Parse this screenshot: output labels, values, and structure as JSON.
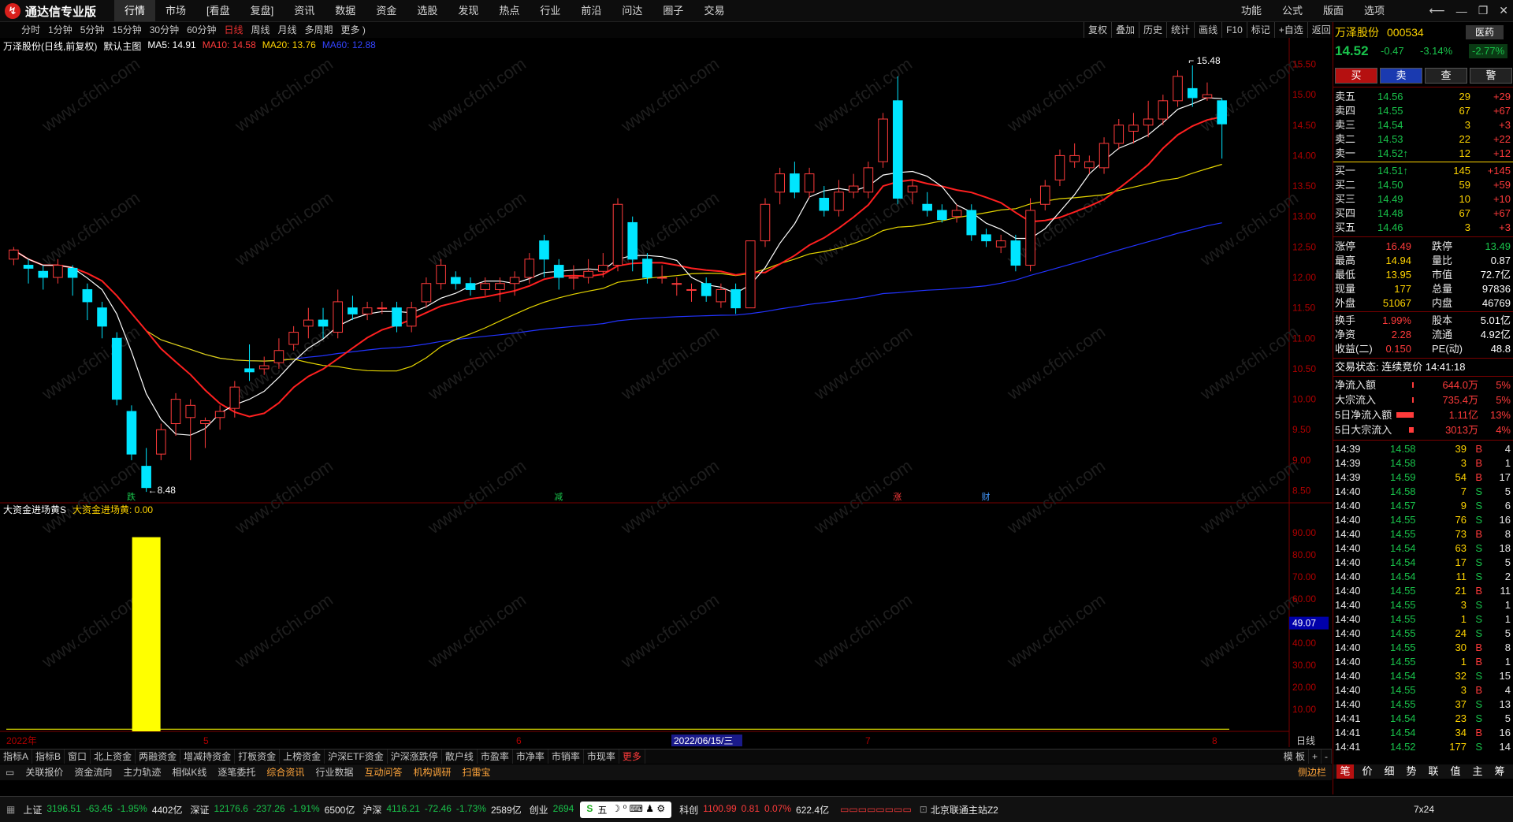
{
  "app": {
    "title": "通达信专业版"
  },
  "menu": [
    "行情",
    "市场",
    "[看盘",
    "复盘]",
    "资讯",
    "数据",
    "资金",
    "选股",
    "发现",
    "热点",
    "行业",
    "前沿",
    "问达",
    "圈子",
    "交易"
  ],
  "menu_active": "行情",
  "right_menu": [
    "功能",
    "公式",
    "版面",
    "选项"
  ],
  "window_controls": [
    "back-arrow",
    "minimize",
    "restore",
    "close"
  ],
  "periods": [
    "分时",
    "1分钟",
    "5分钟",
    "15分钟",
    "30分钟",
    "60分钟",
    "日线",
    "周线",
    "月线",
    "多周期",
    "更多 )"
  ],
  "period_active": "日线",
  "right_tools": [
    "复权",
    "叠加",
    "历史",
    "统计",
    "画线",
    "F10",
    "标记",
    "+自选",
    "返回"
  ],
  "chart_header": {
    "name": "万泽股份(日线,前复权)",
    "theme": "默认主图",
    "ma5": "MA5: 14.91",
    "ma10": "MA10: 14.58",
    "ma20": "MA20: 13.76",
    "ma60": "MA60: 12.88"
  },
  "indicator_header": {
    "name": "大资金进场黄S",
    "value": "大资金进场黄: 0.00"
  },
  "price_axis": [
    "15.50",
    "15.00",
    "14.50",
    "14.00",
    "13.50",
    "13.00",
    "12.50",
    "12.00",
    "11.50",
    "11.00",
    "10.50",
    "10.00",
    "9.50",
    "9.00",
    "8.50"
  ],
  "ind_axis": [
    "90.00",
    "80.00",
    "70.00",
    "60.00",
    "49.07",
    "40.00",
    "30.00",
    "20.00",
    "10.00"
  ],
  "time_axis": {
    "start": "2022年",
    "m5": "5",
    "m6": "6",
    "cursor_date": "2022/06/15/三",
    "m7": "7",
    "m8": "8",
    "period_label": "日线"
  },
  "annotations": {
    "high": "15.48",
    "low": "←8.48",
    "e1": "跌",
    "e2": "减",
    "e3": "涨",
    "e4": "财"
  },
  "chart_data": {
    "type": "candlestick",
    "ylim": [
      8.3,
      15.7
    ],
    "candles": [
      [
        12.3,
        12.45,
        12.2,
        12.5
      ],
      [
        12.2,
        12.15,
        11.9,
        12.3
      ],
      [
        12.1,
        12.0,
        11.8,
        12.2
      ],
      [
        12.0,
        12.2,
        11.9,
        12.3
      ],
      [
        12.15,
        12.0,
        11.7,
        12.2
      ],
      [
        11.8,
        11.6,
        11.3,
        11.9
      ],
      [
        11.5,
        11.2,
        11.0,
        11.6
      ],
      [
        11.0,
        10.0,
        9.9,
        11.1
      ],
      [
        9.8,
        9.1,
        9.0,
        9.9
      ],
      [
        8.9,
        8.55,
        8.48,
        9.2
      ],
      [
        9.1,
        9.5,
        9.0,
        9.6
      ],
      [
        9.6,
        10.0,
        9.4,
        10.1
      ],
      [
        9.7,
        9.9,
        9.0,
        10.0
      ],
      [
        9.6,
        9.65,
        9.2,
        9.7
      ],
      [
        9.7,
        9.8,
        9.5,
        9.9
      ],
      [
        9.85,
        10.2,
        9.7,
        10.3
      ],
      [
        10.5,
        10.45,
        10.3,
        10.9
      ],
      [
        10.5,
        10.55,
        10.4,
        10.7
      ],
      [
        10.6,
        10.8,
        10.5,
        11.0
      ],
      [
        10.9,
        11.1,
        10.8,
        11.2
      ],
      [
        11.2,
        11.3,
        11.0,
        11.5
      ],
      [
        11.3,
        11.2,
        11.0,
        11.5
      ],
      [
        11.1,
        11.6,
        11.0,
        11.8
      ],
      [
        11.5,
        11.4,
        11.3,
        11.7
      ],
      [
        11.4,
        11.5,
        11.3,
        11.6
      ],
      [
        11.5,
        11.5,
        11.4,
        11.6
      ],
      [
        11.5,
        11.2,
        11.1,
        11.6
      ],
      [
        11.2,
        11.5,
        11.1,
        11.6
      ],
      [
        11.6,
        11.9,
        11.5,
        12.0
      ],
      [
        11.9,
        12.2,
        11.8,
        12.3
      ],
      [
        12.0,
        11.9,
        11.8,
        12.1
      ],
      [
        11.9,
        11.8,
        11.7,
        12.0
      ],
      [
        11.8,
        11.9,
        11.7,
        12.0
      ],
      [
        11.8,
        11.9,
        11.6,
        12.0
      ],
      [
        11.9,
        12.0,
        11.7,
        12.1
      ],
      [
        12.0,
        12.3,
        11.9,
        12.4
      ],
      [
        12.6,
        12.3,
        12.0,
        12.7
      ],
      [
        12.2,
        12.0,
        11.8,
        12.3
      ],
      [
        12.0,
        12.0,
        11.8,
        12.2
      ],
      [
        12.0,
        12.1,
        11.9,
        12.3
      ],
      [
        12.1,
        12.2,
        12.0,
        12.4
      ],
      [
        12.2,
        13.2,
        12.1,
        13.3
      ],
      [
        12.9,
        12.3,
        12.1,
        13.0
      ],
      [
        12.3,
        12.0,
        11.9,
        12.4
      ],
      [
        12.0,
        12.0,
        11.9,
        12.2
      ],
      [
        11.9,
        11.9,
        11.7,
        12.0
      ],
      [
        11.8,
        11.8,
        11.6,
        11.9
      ],
      [
        11.9,
        11.7,
        11.6,
        12.0
      ],
      [
        11.6,
        11.8,
        11.5,
        11.9
      ],
      [
        11.8,
        11.5,
        11.4,
        11.9
      ],
      [
        11.5,
        12.6,
        11.5,
        12.6
      ],
      [
        12.6,
        13.2,
        12.5,
        13.3
      ],
      [
        13.4,
        13.7,
        13.2,
        13.8
      ],
      [
        13.7,
        13.4,
        13.3,
        13.9
      ],
      [
        13.4,
        13.7,
        13.3,
        13.8
      ],
      [
        13.3,
        13.1,
        13.0,
        13.5
      ],
      [
        13.1,
        13.4,
        13.0,
        13.6
      ],
      [
        13.4,
        13.5,
        13.3,
        13.7
      ],
      [
        13.4,
        13.8,
        13.3,
        13.9
      ],
      [
        13.9,
        14.6,
        13.8,
        14.7
      ],
      [
        14.9,
        13.3,
        13.2,
        15.3
      ],
      [
        13.4,
        13.5,
        13.2,
        13.6
      ],
      [
        13.2,
        13.1,
        13.0,
        13.4
      ],
      [
        13.1,
        12.95,
        12.9,
        13.2
      ],
      [
        13.0,
        13.1,
        12.9,
        13.2
      ],
      [
        13.1,
        12.7,
        12.6,
        13.2
      ],
      [
        12.7,
        12.6,
        12.5,
        12.8
      ],
      [
        12.5,
        12.6,
        12.4,
        12.7
      ],
      [
        12.6,
        12.2,
        12.1,
        12.7
      ],
      [
        12.2,
        13.1,
        12.1,
        13.3
      ],
      [
        13.2,
        13.5,
        13.1,
        13.6
      ],
      [
        13.6,
        14.0,
        13.5,
        14.1
      ],
      [
        13.9,
        14.0,
        13.8,
        14.2
      ],
      [
        13.8,
        13.9,
        13.7,
        14.0
      ],
      [
        13.8,
        14.2,
        13.7,
        14.3
      ],
      [
        14.2,
        14.5,
        14.1,
        14.6
      ],
      [
        14.4,
        14.5,
        14.2,
        14.7
      ],
      [
        14.5,
        14.6,
        14.3,
        14.9
      ],
      [
        14.6,
        14.9,
        14.5,
        15.0
      ],
      [
        14.9,
        15.3,
        14.8,
        15.4
      ],
      [
        15.1,
        14.95,
        14.8,
        15.48
      ],
      [
        14.95,
        15.0,
        14.9,
        15.2
      ],
      [
        14.9,
        14.52,
        13.95,
        14.94
      ]
    ],
    "ind_bars": [
      {
        "index": 9,
        "value": 88
      }
    ]
  },
  "quote": {
    "stock_name": "万泽股份",
    "stock_code": "000534",
    "industry_btn": "医药",
    "price": "14.52",
    "change": "-0.47",
    "pct": "-3.14%",
    "pct2": "-2.77%",
    "actions": [
      "买",
      "卖",
      "查",
      "警"
    ],
    "sell_levels": [
      [
        "卖五",
        "14.56",
        "29",
        "+29"
      ],
      [
        "卖四",
        "14.55",
        "67",
        "+67"
      ],
      [
        "卖三",
        "14.54",
        "3",
        "+3"
      ],
      [
        "卖二",
        "14.53",
        "22",
        "+22"
      ],
      [
        "卖一",
        "14.52↑",
        "12",
        "+12"
      ]
    ],
    "buy_levels": [
      [
        "买一",
        "14.51↑",
        "145",
        "+145"
      ],
      [
        "买二",
        "14.50",
        "59",
        "+59"
      ],
      [
        "买三",
        "14.49",
        "10",
        "+10"
      ],
      [
        "买四",
        "14.48",
        "67",
        "+67"
      ],
      [
        "买五",
        "14.46",
        "3",
        "+3"
      ]
    ],
    "stats": [
      [
        "涨停",
        "16.49",
        "跌停",
        "13.49"
      ],
      [
        "最高",
        "14.94",
        "量比",
        "0.87"
      ],
      [
        "最低",
        "13.95",
        "市值",
        "72.7亿"
      ],
      [
        "现量",
        "177",
        "总量",
        "97836"
      ],
      [
        "外盘",
        "51067",
        "内盘",
        "46769"
      ]
    ],
    "stats2": [
      [
        "换手",
        "1.99%",
        "股本",
        "5.01亿"
      ],
      [
        "净资",
        "2.28",
        "流通",
        "4.92亿"
      ],
      [
        "收益(二)",
        "0.150",
        "PE(动)",
        "48.8"
      ]
    ],
    "trade_state": "交易状态: 连续竞价 14:41:18",
    "flows": [
      [
        "净流入额",
        "644.0万",
        "5%"
      ],
      [
        "大宗流入",
        "735.4万",
        "5%"
      ],
      [
        "5日净流入额",
        "1.11亿",
        "13%"
      ],
      [
        "5日大宗流入",
        "3013万",
        "4%"
      ]
    ],
    "ticks": [
      [
        "14:39",
        "14.58",
        "39",
        "B",
        "4"
      ],
      [
        "14:39",
        "14.58",
        "3",
        "B",
        "1"
      ],
      [
        "14:39",
        "14.59",
        "54",
        "B",
        "17"
      ],
      [
        "14:40",
        "14.58",
        "7",
        "S",
        "5"
      ],
      [
        "14:40",
        "14.57",
        "9",
        "S",
        "6"
      ],
      [
        "14:40",
        "14.55",
        "76",
        "S",
        "16"
      ],
      [
        "14:40",
        "14.55",
        "73",
        "B",
        "8"
      ],
      [
        "14:40",
        "14.54",
        "63",
        "S",
        "18"
      ],
      [
        "14:40",
        "14.54",
        "17",
        "S",
        "5"
      ],
      [
        "14:40",
        "14.54",
        "11",
        "S",
        "2"
      ],
      [
        "14:40",
        "14.55",
        "21",
        "B",
        "11"
      ],
      [
        "14:40",
        "14.55",
        "3",
        "S",
        "1"
      ],
      [
        "14:40",
        "14.55",
        "1",
        "S",
        "1"
      ],
      [
        "14:40",
        "14.55",
        "24",
        "S",
        "5"
      ],
      [
        "14:40",
        "14.55",
        "30",
        "B",
        "8"
      ],
      [
        "14:40",
        "14.55",
        "1",
        "B",
        "1"
      ],
      [
        "14:40",
        "14.54",
        "32",
        "S",
        "15"
      ],
      [
        "14:40",
        "14.55",
        "3",
        "B",
        "4"
      ],
      [
        "14:40",
        "14.55",
        "37",
        "S",
        "13"
      ],
      [
        "14:41",
        "14.54",
        "23",
        "S",
        "5"
      ],
      [
        "14:41",
        "14.54",
        "34",
        "B",
        "16"
      ],
      [
        "14:41",
        "14.52",
        "177",
        "S",
        "14"
      ]
    ],
    "bottom_tabs": [
      "笔",
      "价",
      "细",
      "势",
      "联",
      "值",
      "主",
      "筹"
    ]
  },
  "tabs1": [
    "指标A",
    "指标B",
    "窗口",
    "北上资金",
    "两融资金",
    "增减持资金",
    "打板资金",
    "上榜资金",
    "沪深ETF资金",
    "沪深涨跌停",
    "散户线",
    "市盈率",
    "市净率",
    "市销率",
    "市现率",
    "更多"
  ],
  "tabs1_right": [
    "模 板",
    "+",
    "-"
  ],
  "tabs2": [
    "关联报价",
    "资金流向",
    "主力轨迹",
    "相似K线",
    "逐笔委托",
    "综合资讯",
    "行业数据",
    "互动问答",
    "机构调研",
    "扫雷宝"
  ],
  "side_bar_label": "侧边栏",
  "status": {
    "sh": [
      "上证",
      "3196.51",
      "-63.45",
      "-1.95%",
      "4402亿"
    ],
    "sz": [
      "深证",
      "12176.6",
      "-237.26",
      "-1.91%",
      "6500亿"
    ],
    "hs": [
      "沪深",
      "4116.21",
      "-72.46",
      "-1.73%",
      "2589亿"
    ],
    "cy": [
      "创业",
      "2694"
    ],
    "kc": [
      "科创",
      "1100.99",
      "0.81",
      "0.07%",
      "622.4亿"
    ],
    "ime": "五",
    "conn": "北京联通主站Z2",
    "right": "7x24"
  },
  "watermark": "www.cfchi.com",
  "colors": {
    "up": "#ff3b3b",
    "down": "#00e5ff",
    "ma5": "#ffffff",
    "ma10": "#ff2020",
    "ma20": "#e5d500",
    "ma60": "#2233ff",
    "ind": "#ffff00"
  }
}
